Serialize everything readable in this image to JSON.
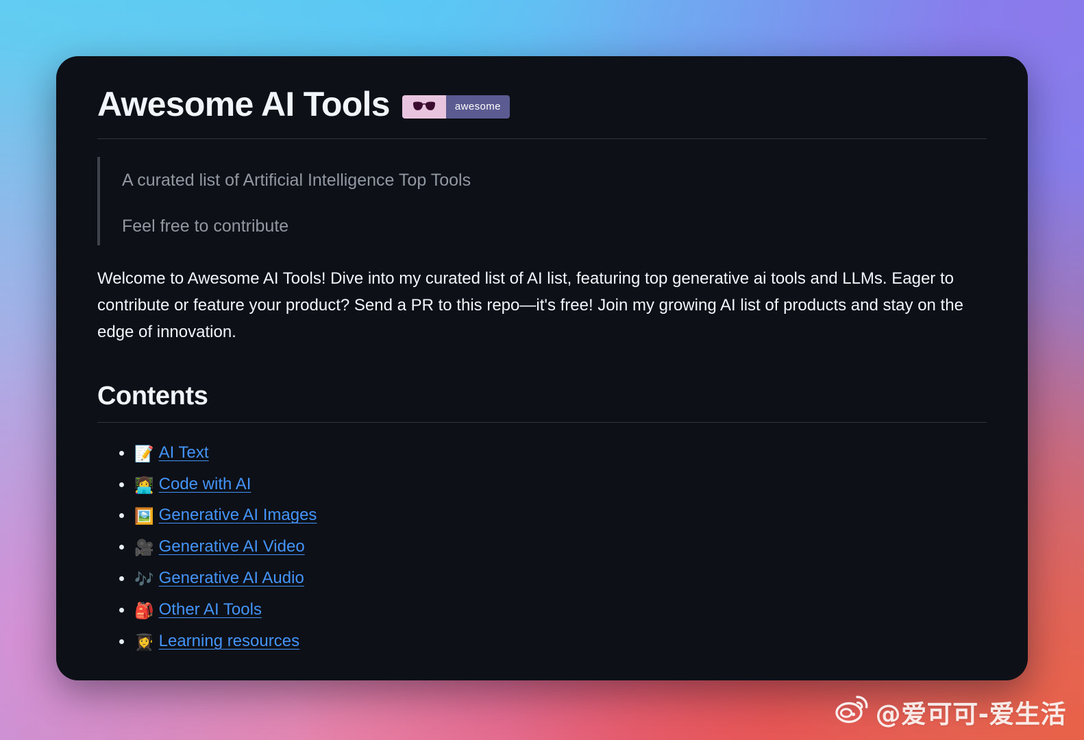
{
  "background": {
    "gradient_colors": [
      "#4ed0f6",
      "#60c4f3",
      "#6c88ee",
      "#8b79eb",
      "#cd96e7",
      "#e984a8",
      "#e24660",
      "#e96248"
    ]
  },
  "card": {
    "background_color": "#0d1117",
    "title": "Awesome AI Tools",
    "badge": {
      "icon": "sunglasses-icon",
      "label": "awesome",
      "left_color": "#e9c4de",
      "right_color": "#5b5b92"
    },
    "blockquote": [
      "A curated list of Artificial Intelligence Top Tools",
      "Feel free to contribute"
    ],
    "intro": "Welcome to Awesome AI Tools! Dive into my curated list of AI list, featuring top generative ai tools and LLMs. Eager to contribute or feature your product? Send a PR to this repo—it's free! Join my growing AI list of products and stay on the edge of innovation.",
    "contents": {
      "heading": "Contents",
      "link_color": "#4493f8",
      "items": [
        {
          "emoji": "📝",
          "icon_name": "memo-icon",
          "label": "AI Text"
        },
        {
          "emoji": "👩‍💻",
          "icon_name": "woman-technologist-icon",
          "label": "Code with AI"
        },
        {
          "emoji": "🖼️",
          "icon_name": "framed-picture-icon",
          "label": "Generative AI Images"
        },
        {
          "emoji": "🎥",
          "icon_name": "movie-camera-icon",
          "label": "Generative AI Video"
        },
        {
          "emoji": "🎶",
          "icon_name": "musical-notes-icon",
          "label": "Generative AI Audio"
        },
        {
          "emoji": "🎒",
          "icon_name": "backpack-icon",
          "label": "Other AI Tools"
        },
        {
          "emoji": "👩‍🎓",
          "icon_name": "woman-student-icon",
          "label": "Learning resources"
        }
      ]
    }
  },
  "watermark": {
    "icon": "weibo-logo-icon",
    "text": "@爱可可-爱生活"
  }
}
